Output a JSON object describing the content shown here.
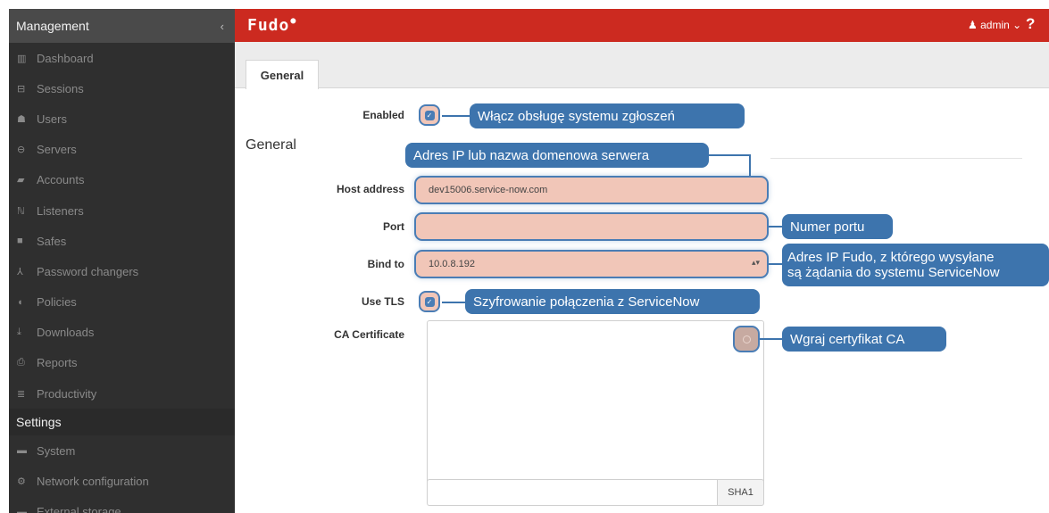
{
  "sidebar": {
    "header": "Management",
    "collapse_icon": "‹",
    "items": [
      {
        "label": "Dashboard",
        "icon": "bar-chart-icon",
        "glyph": "▥"
      },
      {
        "label": "Sessions",
        "icon": "film-icon",
        "glyph": "⊟"
      },
      {
        "label": "Users",
        "icon": "users-icon",
        "glyph": "☗"
      },
      {
        "label": "Servers",
        "icon": "server-icon",
        "glyph": "⊖"
      },
      {
        "label": "Accounts",
        "icon": "account-icon",
        "glyph": "▰"
      },
      {
        "label": "Listeners",
        "icon": "rss-icon",
        "glyph": "ℕ"
      },
      {
        "label": "Safes",
        "icon": "safe-icon",
        "glyph": "■"
      },
      {
        "label": "Password changers",
        "icon": "sitemap-icon",
        "glyph": "⅄"
      },
      {
        "label": "Policies",
        "icon": "shield-icon",
        "glyph": "◖"
      },
      {
        "label": "Downloads",
        "icon": "download-icon",
        "glyph": "⤓"
      },
      {
        "label": "Reports",
        "icon": "print-icon",
        "glyph": "⎙"
      },
      {
        "label": "Productivity",
        "icon": "productivity-icon",
        "glyph": "≣"
      }
    ],
    "section": "Settings",
    "settings_items": [
      {
        "label": "System",
        "icon": "folder-icon",
        "glyph": "▬"
      },
      {
        "label": "Network configuration",
        "icon": "cogs-icon",
        "glyph": "⚙"
      },
      {
        "label": "External storage",
        "icon": "storage-icon",
        "glyph": "▬"
      }
    ]
  },
  "topbar": {
    "logo": "Fudo",
    "user": "admin",
    "user_glyph": "♟",
    "user_chevron": "⌄",
    "help": "?"
  },
  "tabs": [
    {
      "label": "General",
      "active": true
    }
  ],
  "form": {
    "section_title": "General",
    "enabled_label": "Enabled",
    "enabled_checked": true,
    "host_label": "Host address",
    "host_value": "dev15006.service-now.com",
    "port_label": "Port",
    "port_value": "",
    "bind_label": "Bind to",
    "bind_value": "10.0.8.192",
    "tls_label": "Use TLS",
    "tls_checked": true,
    "ca_label": "CA Certificate",
    "sha_button": "SHA1"
  },
  "callouts": {
    "enabled": "Włącz obsługę systemu zgłoszeń",
    "host": "Adres IP lub nazwa domenowa serwera",
    "port": "Numer portu",
    "bind_line1": "Adres IP Fudo, z którego wysyłane",
    "bind_line2": "są żądania do systemu ServiceNow",
    "tls": "Szyfrowanie połączenia z ServiceNow",
    "ca": "Wgraj certyfikat CA"
  },
  "colors": {
    "topbar": "#cc2a20",
    "sidebar": "#2f2f2f",
    "callout": "#3d74ad",
    "highlight": "#f1c6b8"
  }
}
